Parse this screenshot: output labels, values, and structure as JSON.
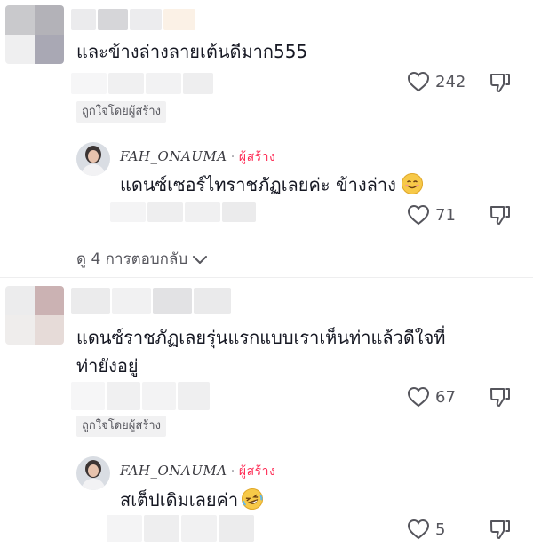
{
  "comments": [
    {
      "text": "และข้างล่างลายเต้นดีมาก555",
      "likes": "242",
      "liked_by_creator": "ถูกใจโดยผู้สร้าง",
      "reply": {
        "author": "FAH_ONAUMA",
        "author_tag": "ผู้สร้าง",
        "text": "แดนซ์เซอร์ไทราชภัฏเลยค่ะ ข้างล่าง",
        "likes": "71"
      },
      "view_replies": "ดู 4 การตอบกลับ"
    },
    {
      "text_line1": "แดนซ์ราชภัฏเลยรุ่นแรกแบบเราเห็นท่าแล้วดีใจที่",
      "text_line2": "ท่ายังอยู่",
      "likes": "67",
      "liked_by_creator": "ถูกใจโดยผู้สร้าง",
      "reply": {
        "author": "FAH_ONAUMA",
        "author_tag": "ผู้สร้าง",
        "text": "สเต็ปเดิมเลยค่า",
        "likes": "5"
      }
    }
  ],
  "colors": {
    "creator_accent": "#fe2c55",
    "text_primary": "#161823",
    "text_secondary": "#57575e"
  },
  "icons": [
    "heart-icon",
    "dislike-icon",
    "chevron-down-icon",
    "smiling-face-icon",
    "rolling-laughing-face-icon"
  ]
}
